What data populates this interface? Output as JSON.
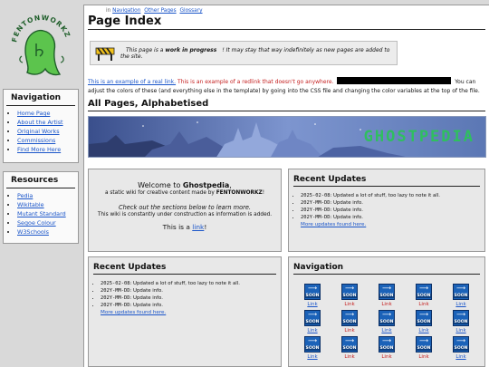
{
  "logo": {
    "text": "FENTONWORKZ"
  },
  "sidebar": {
    "nav_title": "Navigation",
    "nav_items": [
      "Home Page",
      "About the Artist",
      "Original Works",
      "Commissions",
      "Find More Here"
    ],
    "res_title": "Resources",
    "res_items": [
      "Pedia",
      "Wikitable",
      "Mutant Standard",
      "Segoe Colour",
      "W3Schools"
    ]
  },
  "breadcrumbs": {
    "prefix": "in",
    "items": [
      "Navigation",
      "Other Pages",
      "Glossary"
    ]
  },
  "page_title": "Page Index",
  "notice": {
    "pre": "This page is a ",
    "bold": "work in progress",
    "post": "! It may stay that way indefinitely as new pages are added to the site."
  },
  "intro": {
    "real_link": "This is an example of a real link.",
    "red_link": "This is an example of a redlink that doesn't go anywhere.",
    "after_redact": "You can adjust the colors of these (and everything else in the template) by going into the CSS file and changing the color variables at the top of the file."
  },
  "section_title": "All Pages, Alphabetised",
  "banner": {
    "text": "GHOSTPEDIA"
  },
  "welcome": {
    "title_pre": "Welcome to ",
    "title_bold": "Ghostpedia",
    "title_post": ",",
    "sub_pre": "a static wiki for creative content made by ",
    "sub_bold": "FENTONWORKZ",
    "sub_post": "!",
    "italic": "Check out the sections below to learn more.",
    "construction": "This wiki is constantly under construction as information is added.",
    "link_pre": "This is a ",
    "link": "link",
    "link_post": "!"
  },
  "recent_updates": {
    "title": "Recent Updates",
    "items": [
      {
        "date": "2025-02-08",
        "text": ": Updated a lot of stuff, too lazy to note it all."
      },
      {
        "date": "202Y-MM-DD",
        "text": ": Update info."
      },
      {
        "date": "202Y-MM-DD",
        "text": ": Update info."
      },
      {
        "date": "202Y-MM-DD",
        "text": ": Update info."
      }
    ],
    "more": "More updates found here."
  },
  "nav_card": {
    "title": "Navigation",
    "icon_text": "SOON",
    "row1": [
      {
        "label": "Link",
        "red": false
      },
      {
        "label": "Link",
        "red": true
      },
      {
        "label": "Link",
        "red": true
      },
      {
        "label": "Link",
        "red": true
      },
      {
        "label": "Link",
        "red": false
      }
    ],
    "row2": [
      {
        "label": "Link",
        "red": false
      },
      {
        "label": "Link",
        "red": true
      },
      {
        "label": "Link",
        "red": false
      },
      {
        "label": "Link",
        "red": false
      },
      {
        "label": "Link",
        "red": false
      }
    ]
  }
}
